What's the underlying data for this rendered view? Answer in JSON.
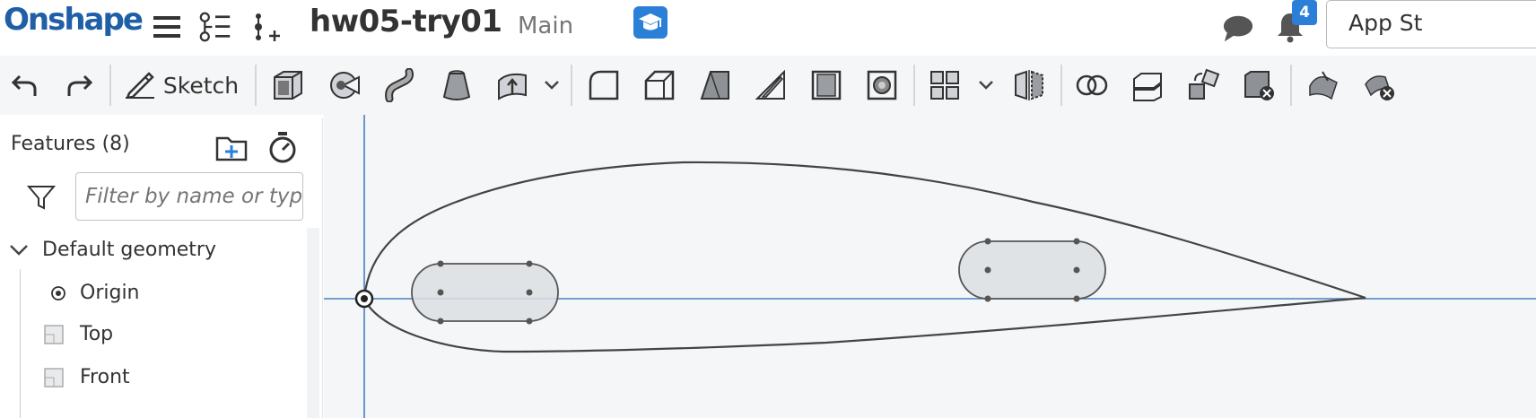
{
  "app": {
    "logo": "Onshape"
  },
  "document": {
    "title": "hw05-try01",
    "branch": "Main"
  },
  "notifications": {
    "count": "4"
  },
  "app_store": {
    "label": "App St"
  },
  "toolbar": {
    "sketch_label": "Sketch"
  },
  "features": {
    "title": "Features (8)",
    "filter_placeholder": "Filter by name or type",
    "group_label": "Default geometry",
    "items": [
      {
        "label": "Origin",
        "icon": "origin-icon"
      },
      {
        "label": "Top",
        "icon": "plane-icon"
      },
      {
        "label": "Front",
        "icon": "plane-icon"
      }
    ]
  },
  "colors": {
    "brand": "#1e5fa8",
    "accent": "#2b7fd6",
    "axis": "#4a7fc0",
    "sketch_fill": "#dcdfe3"
  }
}
